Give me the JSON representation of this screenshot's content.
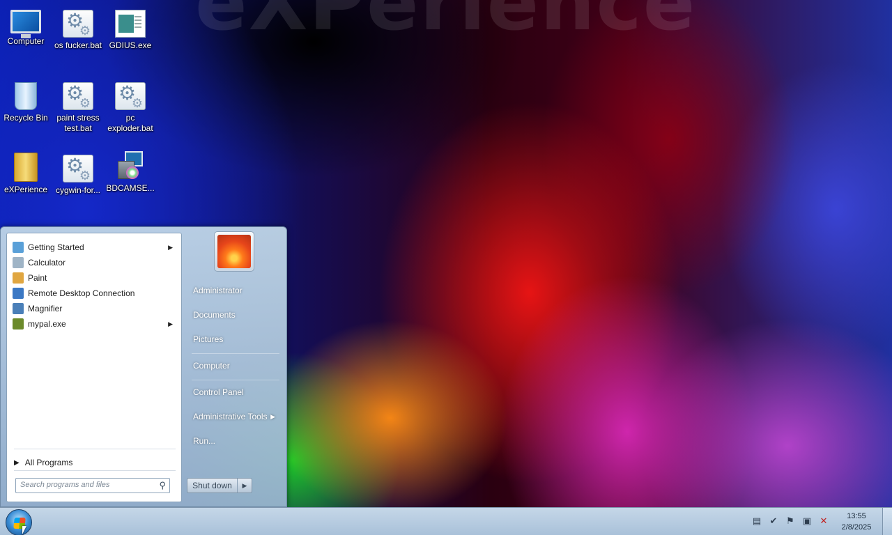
{
  "desktop": {
    "icons": [
      {
        "label": "Computer",
        "icon": "computer-icon"
      },
      {
        "label": "os fucker.bat",
        "icon": "batch-file-icon"
      },
      {
        "label": "GDIUS.exe",
        "icon": "executable-icon"
      },
      {
        "label": "Recycle Bin",
        "icon": "recycle-bin-icon"
      },
      {
        "label": "paint stress test.bat",
        "icon": "batch-file-icon"
      },
      {
        "label": "pc exploder.bat",
        "icon": "batch-file-icon"
      },
      {
        "label": "eXPerience",
        "icon": "folder-icon"
      },
      {
        "label": "cygwin-for...",
        "icon": "batch-file-icon"
      },
      {
        "label": "BDCAMSE...",
        "icon": "installer-icon"
      }
    ]
  },
  "start_menu": {
    "programs": [
      {
        "label": "Getting Started",
        "has_submenu": true,
        "icon": "getting-started-icon",
        "color": "#5aa0d8"
      },
      {
        "label": "Calculator",
        "has_submenu": false,
        "icon": "calculator-icon",
        "color": "#9fb4c6"
      },
      {
        "label": "Paint",
        "has_submenu": false,
        "icon": "paint-icon",
        "color": "#e0a640"
      },
      {
        "label": "Remote Desktop Connection",
        "has_submenu": false,
        "icon": "remote-desktop-icon",
        "color": "#3b78c4"
      },
      {
        "label": "Magnifier",
        "has_submenu": false,
        "icon": "magnifier-icon",
        "color": "#4a7fb8"
      },
      {
        "label": "mypal.exe",
        "has_submenu": true,
        "icon": "mypal-icon",
        "color": "#6b8a2a"
      }
    ],
    "all_programs": "All Programs",
    "search_placeholder": "Search programs and files",
    "right_links": [
      {
        "label": "Administrator",
        "has_submenu": false
      },
      {
        "label": "Documents",
        "has_submenu": false
      },
      {
        "label": "Pictures",
        "has_submenu": false
      },
      {
        "label": "Computer",
        "has_submenu": false
      },
      {
        "label": "Control Panel",
        "has_submenu": false
      },
      {
        "label": "Administrative Tools",
        "has_submenu": true
      },
      {
        "label": "Run...",
        "has_submenu": false
      }
    ],
    "shutdown_label": "Shut down"
  },
  "taskbar": {
    "clock_time": "13:55",
    "clock_date": "2/8/2025",
    "tray_icons": [
      "notes-icon",
      "security-icon",
      "action-center-flag-icon",
      "network-icon",
      "volume-muted-icon"
    ]
  }
}
